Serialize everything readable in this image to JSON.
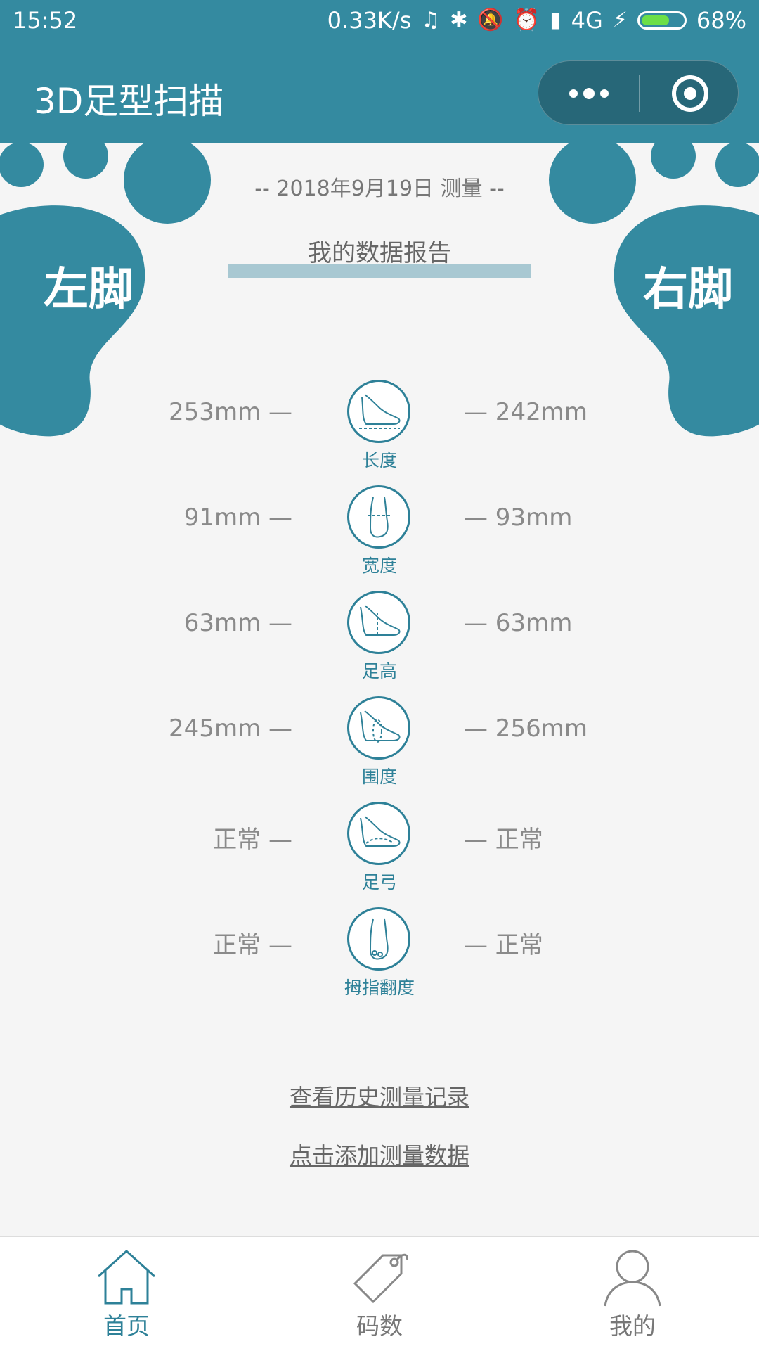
{
  "status_bar": {
    "time": "15:52",
    "network_speed": "0.33K/s",
    "network_type": "4G",
    "battery": "68%",
    "battery_level": 0.68
  },
  "titlebar": {
    "title": "3D足型扫描"
  },
  "feet": {
    "left_label": "左脚",
    "right_label": "右脚"
  },
  "report": {
    "date_line": "-- 2018年9月19日 测量 --",
    "title": "我的数据报告"
  },
  "measurements": [
    {
      "label": "长度",
      "left": "253mm —",
      "right": "— 242mm",
      "icon": "foot-length-icon"
    },
    {
      "label": "宽度",
      "left": "91mm —",
      "right": "— 93mm",
      "icon": "foot-width-icon"
    },
    {
      "label": "足高",
      "left": "63mm —",
      "right": "— 63mm",
      "icon": "foot-height-icon"
    },
    {
      "label": "围度",
      "left": "245mm —",
      "right": "— 256mm",
      "icon": "foot-girth-icon"
    },
    {
      "label": "足弓",
      "left": "正常 —",
      "right": "— 正常",
      "icon": "foot-arch-icon"
    },
    {
      "label": "拇指翻度",
      "left": "正常 —",
      "right": "— 正常",
      "icon": "toe-angle-icon"
    }
  ],
  "links": {
    "history": "查看历史测量记录",
    "add": "点击添加测量数据"
  },
  "tabbar": {
    "items": [
      {
        "label": "首页",
        "icon": "home-icon",
        "active": true
      },
      {
        "label": "码数",
        "icon": "tag-icon",
        "active": false
      },
      {
        "label": "我的",
        "icon": "user-icon",
        "active": false
      }
    ]
  },
  "colors": {
    "primary": "#348aa0",
    "accent": "#2e8198",
    "bar": "#a8c8d2"
  }
}
